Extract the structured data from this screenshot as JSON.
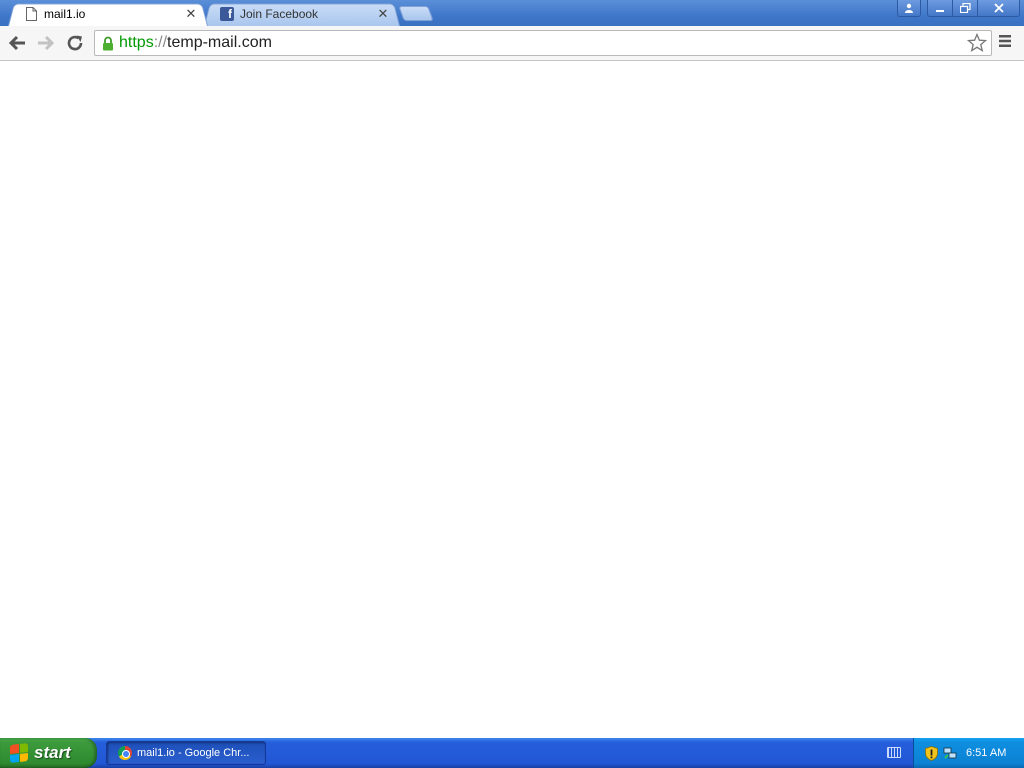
{
  "tabs": [
    {
      "title": "mail1.io",
      "icon": "page-icon",
      "active": true
    },
    {
      "title": "Join Facebook",
      "icon": "facebook-icon",
      "active": false
    }
  ],
  "window_controls": {
    "profile": "profile-icon",
    "minimize": "minimize-icon",
    "maximize": "restore-icon",
    "close": "close-icon"
  },
  "toolbar": {
    "url_scheme": "https",
    "url_separator": "://",
    "url_host": "temp-mail.com",
    "secure": true
  },
  "taskbar": {
    "start_label": "start",
    "tasks": [
      {
        "label": "mail1.io - Google Chr...",
        "icon": "chrome-icon"
      }
    ],
    "clock": "6:51 AM"
  },
  "colors": {
    "titlebar": "#3f77c9",
    "taskbar": "#245edb",
    "start_button": "#3c9a3c",
    "url_scheme": "#009a00"
  }
}
